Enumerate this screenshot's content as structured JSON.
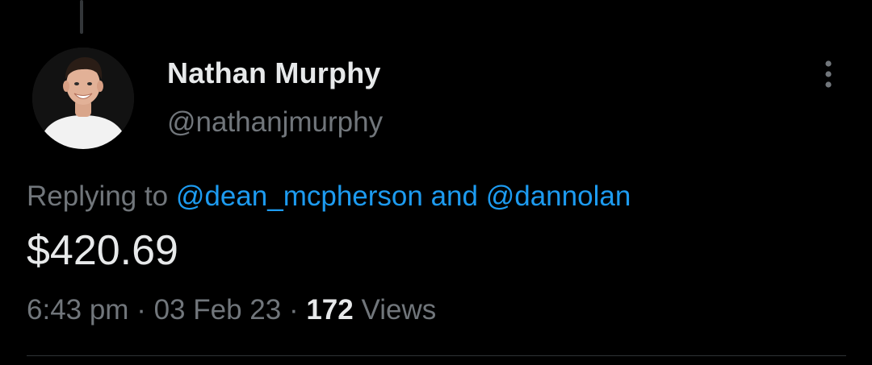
{
  "author": {
    "display_name": "Nathan Murphy",
    "handle": "@nathanjmurphy"
  },
  "reply_context": {
    "prefix": "Replying to",
    "mentions": [
      "@dean_mcpherson",
      "@dannolan"
    ],
    "joiner": "and"
  },
  "tweet": {
    "text": "$420.69"
  },
  "meta": {
    "time": "6:43 pm",
    "separator": "·",
    "date": "03 Feb 23",
    "views_count": "172",
    "views_label": "Views"
  },
  "icons": {
    "more": "more-dots-icon",
    "avatar": "profile-avatar"
  },
  "colors": {
    "background": "#000000",
    "primary_text": "#e7e9ea",
    "secondary_text": "#71767b",
    "accent": "#1d9bf0",
    "divider": "#2f3336"
  }
}
